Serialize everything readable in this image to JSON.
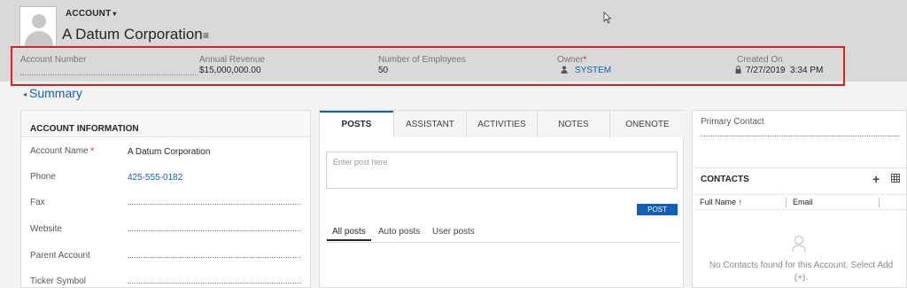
{
  "header": {
    "entity_type": "ACCOUNT",
    "caret": "▾",
    "record_name": "A Datum Corporation",
    "menu_glyph": "≡"
  },
  "header_fields": {
    "account_number": {
      "label": "Account Number",
      "value": ""
    },
    "annual_revenue": {
      "label": "Annual Revenue",
      "value": "$15,000,000.00"
    },
    "employees": {
      "label": "Number of Employees",
      "value": "50"
    },
    "owner": {
      "label": "Owner",
      "required": "*",
      "value": "SYSTEM"
    },
    "created_on": {
      "label": "Created On",
      "value": "7/27/2019  3:34 PM"
    }
  },
  "summary": {
    "toggle": "◂",
    "label": "Summary"
  },
  "account_info": {
    "title": "ACCOUNT INFORMATION",
    "fields": [
      {
        "label": "Account Name",
        "required": "*",
        "value": "A Datum Corporation"
      },
      {
        "label": "Phone",
        "value": "425-555-0182"
      },
      {
        "label": "Fax",
        "value": ""
      },
      {
        "label": "Website",
        "value": ""
      },
      {
        "label": "Parent Account",
        "value": ""
      },
      {
        "label": "Ticker Symbol",
        "value": ""
      }
    ]
  },
  "activity": {
    "tabs": [
      "POSTS",
      "ASSISTANT",
      "ACTIVITIES",
      "NOTES",
      "ONENOTE"
    ],
    "active_tab": "POSTS",
    "post_placeholder": "Enter post here",
    "post_button": "POST",
    "subtabs": [
      "All posts",
      "Auto posts",
      "User posts"
    ]
  },
  "contacts": {
    "primary_contact_label": "Primary Contact",
    "title": "CONTACTS",
    "add_glyph": "+",
    "columns": [
      "Full Name ↑",
      "Email"
    ],
    "empty_message": "No Contacts found for this Account. Select Add (+)."
  },
  "colors": {
    "link": "#1160b7",
    "highlight": "#e02020",
    "header_bg": "#d9d9d9"
  }
}
